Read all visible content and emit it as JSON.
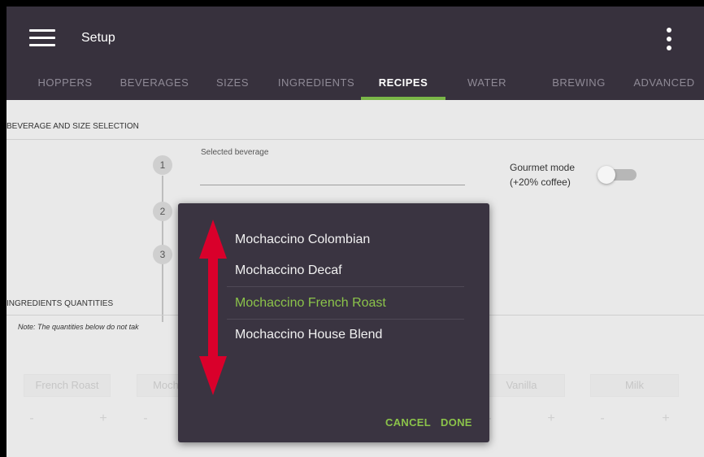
{
  "app": {
    "title": "Setup"
  },
  "tabs": [
    {
      "label": "HOPPERS"
    },
    {
      "label": "BEVERAGES"
    },
    {
      "label": "SIZES"
    },
    {
      "label": "INGREDIENTS"
    },
    {
      "label": "RECIPES",
      "active": true
    },
    {
      "label": "WATER"
    },
    {
      "label": "BREWING"
    },
    {
      "label": "ADVANCED"
    }
  ],
  "sections": {
    "beverage_size": "BEVERAGE AND SIZE SELECTION",
    "ingredients": "INGREDIENTS QUANTITIES"
  },
  "steps": [
    "1",
    "2",
    "3"
  ],
  "selected_beverage": {
    "label": "Selected beverage",
    "value": ""
  },
  "gourmet": {
    "line1": "Gourmet mode",
    "line2": "(+20% coffee)",
    "enabled": false
  },
  "note": "Note: The quantities below do not tak",
  "ingredient_chips": [
    "French Roast",
    "Moch",
    "Vanilla",
    "Milk"
  ],
  "steppers": {
    "minus": "-",
    "plus": "+"
  },
  "dialog": {
    "options": [
      {
        "label": "Mochaccino Colombian",
        "selected": false
      },
      {
        "label": "Mochaccino Decaf",
        "selected": false
      },
      {
        "label": "Mochaccino French Roast",
        "selected": true
      },
      {
        "label": "Mochaccino House Blend",
        "selected": false
      }
    ],
    "cancel_label": "CANCEL",
    "done_label": "DONE"
  },
  "colors": {
    "appbar": "#37313d",
    "accent": "#7ab648",
    "dialog_bg": "#3a3441",
    "selected_text": "#8bc34a",
    "scroll_arrow": "#d9002b"
  },
  "icons": [
    "menu-icon",
    "more-vert-icon",
    "scroll-arrow-icon"
  ]
}
